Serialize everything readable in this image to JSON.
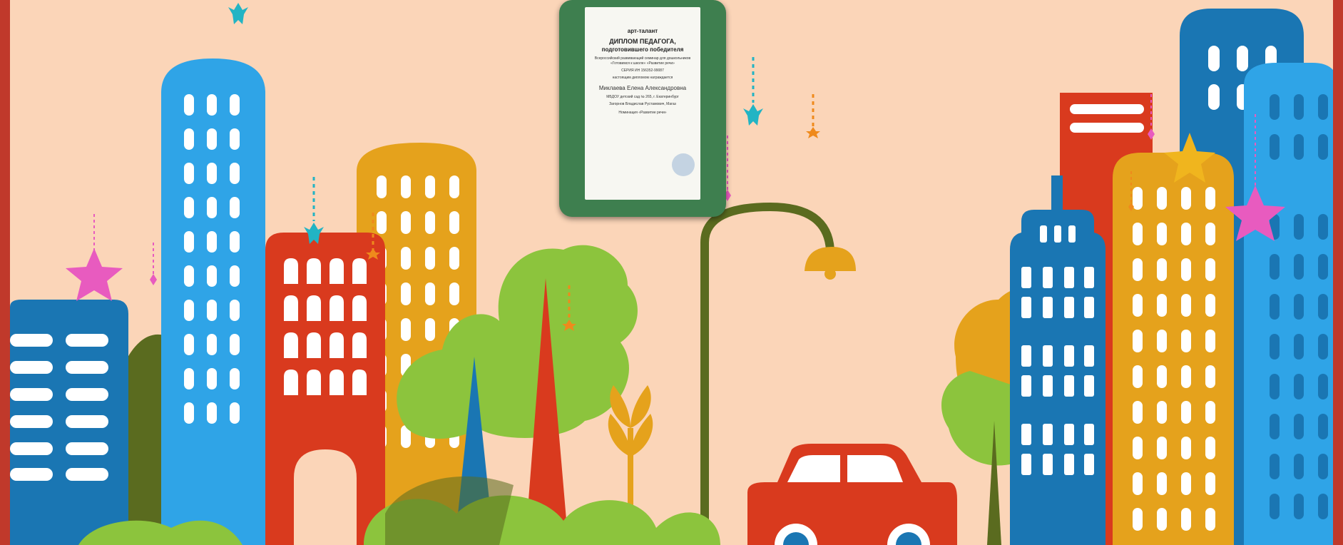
{
  "diploma": {
    "org": "арт-талант",
    "title": "ДИПЛОМ ПЕДАГОГА,",
    "subtitle": "подготовившего победителя",
    "event_line1": "Всероссийский развивающий семинар для дошкольников",
    "event_line2": "«Готовимся к школе» «Развитие речи»",
    "series": "СЕРИЯ ИН 156352-99087",
    "awarded": "настоящим дипломом награждается",
    "name": "Миклаева Елена Александровна",
    "institution": "МБДОУ детский сад № 265, г. Екатеринбург",
    "student": "Загорнов Владислав Рустамович, Магаз",
    "nomination": "Номинация «Развитие речи»"
  },
  "colors": {
    "background": "#fbd5b8",
    "border": "#c0392b",
    "blue_light": "#2fa4e7",
    "blue_dark": "#1a76b3",
    "red": "#d93a1e",
    "orange": "#e5a21c",
    "green": "#8cc43d",
    "olive": "#5a6b1f",
    "pink_star": "#e85bbf",
    "yellow_star": "#f0b51e",
    "teal_star": "#22b4c4"
  }
}
